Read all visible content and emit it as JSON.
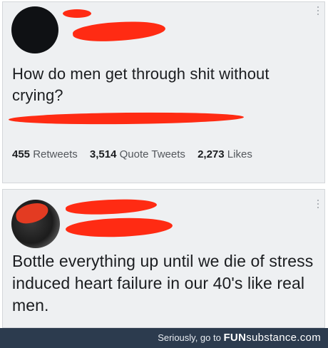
{
  "tweet": {
    "text": "How do men get through shit without crying?",
    "stats": {
      "retweets_count": "455",
      "retweets_label": "Retweets",
      "quotes_count": "3,514",
      "quotes_label": "Quote Tweets",
      "likes_count": "2,273",
      "likes_label": "Likes"
    }
  },
  "reply": {
    "text": "Bottle everything up until we die of stress induced heart failure in our 40's like real men."
  },
  "footer": {
    "prefix": "Seriously, go to ",
    "brand_bold": "FUN",
    "brand_rest": "substance.com"
  },
  "colors": {
    "redaction": "#ff2b13",
    "panel_background": "#eef0f2",
    "footer_background": "#2c3b4e"
  },
  "icons": [
    "more-options-icon",
    "avatar"
  ]
}
